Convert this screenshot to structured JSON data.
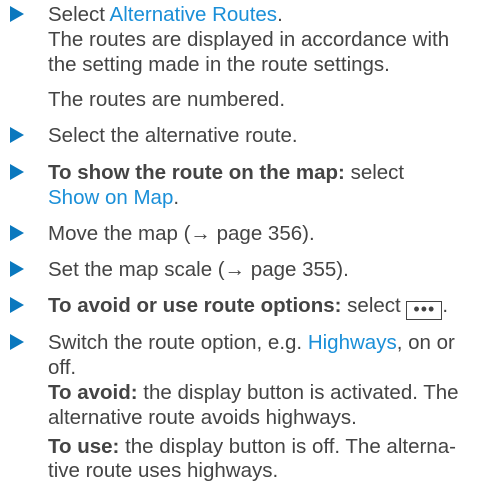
{
  "steps": [
    {
      "lines": [
        {
          "prefix": "Select ",
          "link": "Alternative Routes",
          "suffix": "."
        },
        {
          "text": "The routes are displayed in accordance with"
        },
        {
          "text": "the setting made in the route settings."
        }
      ],
      "note": "The routes are numbered."
    },
    {
      "text": "Select the alternative route."
    },
    {
      "bold": "To show the route on the map:",
      "after_bold": " select",
      "link": "Show on Map",
      "link_suffix": "."
    },
    {
      "text": "Move the map (→ page 356)."
    },
    {
      "text": "Set the map scale (→ page 355)."
    },
    {
      "bold": "To avoid or use route options:",
      "after_bold": " select ",
      "key": "•••",
      "key_suffix": "."
    },
    {
      "prefix": "Switch the route option, e.g. ",
      "link": "Highways",
      "suffix": ", on or",
      "line2": "off.",
      "avoid_label": "To avoid:",
      "avoid_text_1": " the display button is activated. The",
      "avoid_text_2": "alternative route avoids highways.",
      "use_label": "To use:",
      "use_text_1": " the display button is off. The alterna-",
      "use_text_2": "tive route uses highways."
    }
  ],
  "colors": {
    "bullet": "#0a78be",
    "link": "#1a8fd8",
    "text": "#444444"
  },
  "icons": {
    "bullet": "triangle-bullet-icon"
  }
}
